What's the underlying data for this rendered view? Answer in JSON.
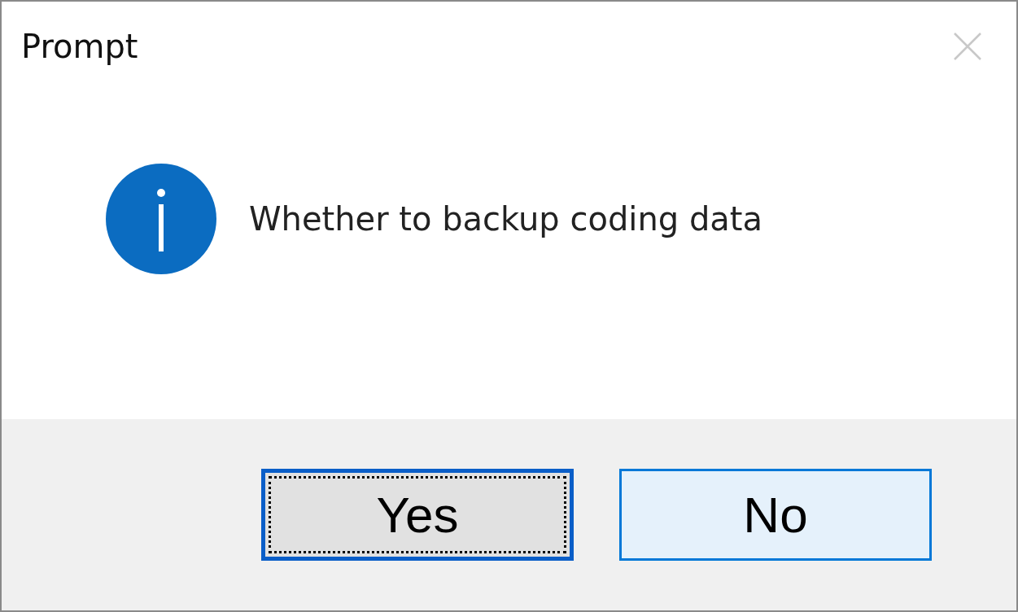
{
  "window": {
    "title": "Prompt"
  },
  "message": "Whether to backup coding data",
  "buttons": [
    {
      "label": "Yes",
      "focused": true
    },
    {
      "label": "No",
      "focused": false
    }
  ]
}
